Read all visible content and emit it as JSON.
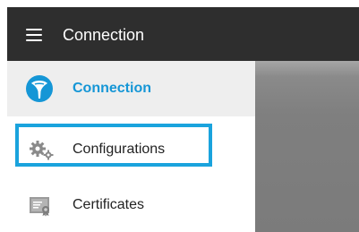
{
  "app_bar": {
    "title": "Connection",
    "menu_icon": "hamburger-menu-icon",
    "background": "#2e2e2e"
  },
  "drawer": {
    "items": [
      {
        "label": "Connection",
        "icon": "connection-logo-icon",
        "active": true,
        "color": "#1596d6"
      },
      {
        "label": "Configurations",
        "icon": "gears-icon",
        "active": false
      },
      {
        "label": "Certificates",
        "icon": "certificate-icon",
        "active": false
      }
    ]
  },
  "highlight_color": "#1aa3dd"
}
